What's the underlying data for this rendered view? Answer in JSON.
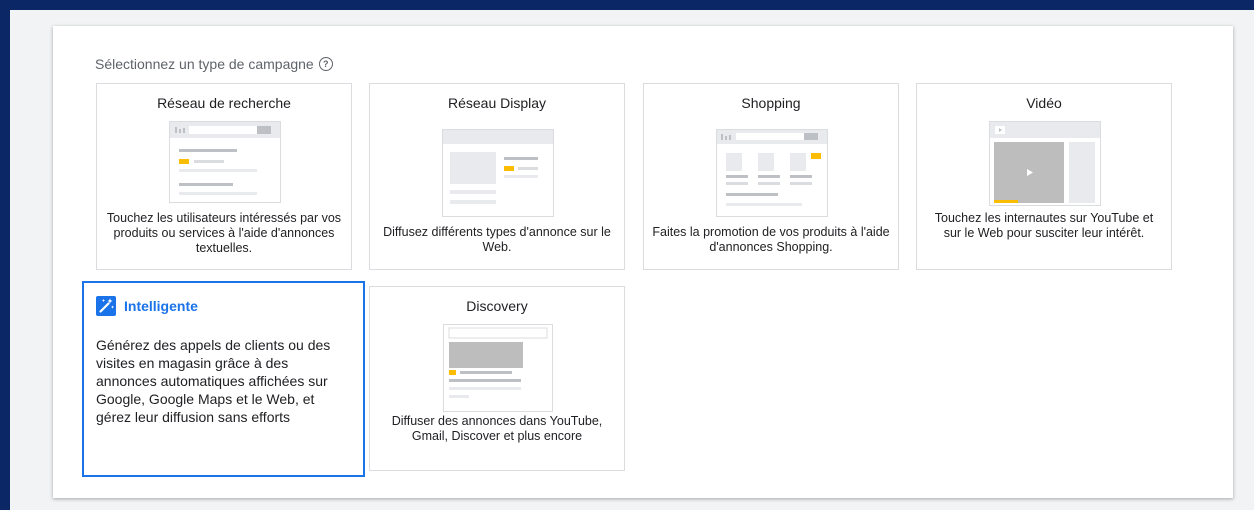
{
  "heading": {
    "label": "Sélectionnez un type de campagne",
    "help_icon": "help-circle-icon"
  },
  "colors": {
    "frame": "#0b2766",
    "accent": "#1a73e8",
    "highlight": "#fbbc04"
  },
  "campaign_types": [
    {
      "title": "Réseau de recherche",
      "description": "Touchez les utilisateurs intéressés par vos produits ou services à l'aide d'annonces textuelles."
    },
    {
      "title": "Réseau Display",
      "description": "Diffusez différents types d'annonce sur le Web."
    },
    {
      "title": "Shopping",
      "description": "Faites la promotion de vos produits à l'aide d'annonces Shopping."
    },
    {
      "title": "Vidéo",
      "description": "Touchez les internautes sur YouTube et sur le Web pour susciter leur intérêt."
    },
    {
      "title": "Intelligente",
      "description": "Générez des appels de clients ou des visites en magasin grâce à des annonces automatiques affichées sur Google, Google Maps et le Web, et gérez leur diffusion sans efforts",
      "icon": "magic-wand-icon",
      "selected": true
    },
    {
      "title": "Discovery",
      "description": "Diffuser des annonces dans YouTube, Gmail, Discover et plus encore"
    }
  ]
}
